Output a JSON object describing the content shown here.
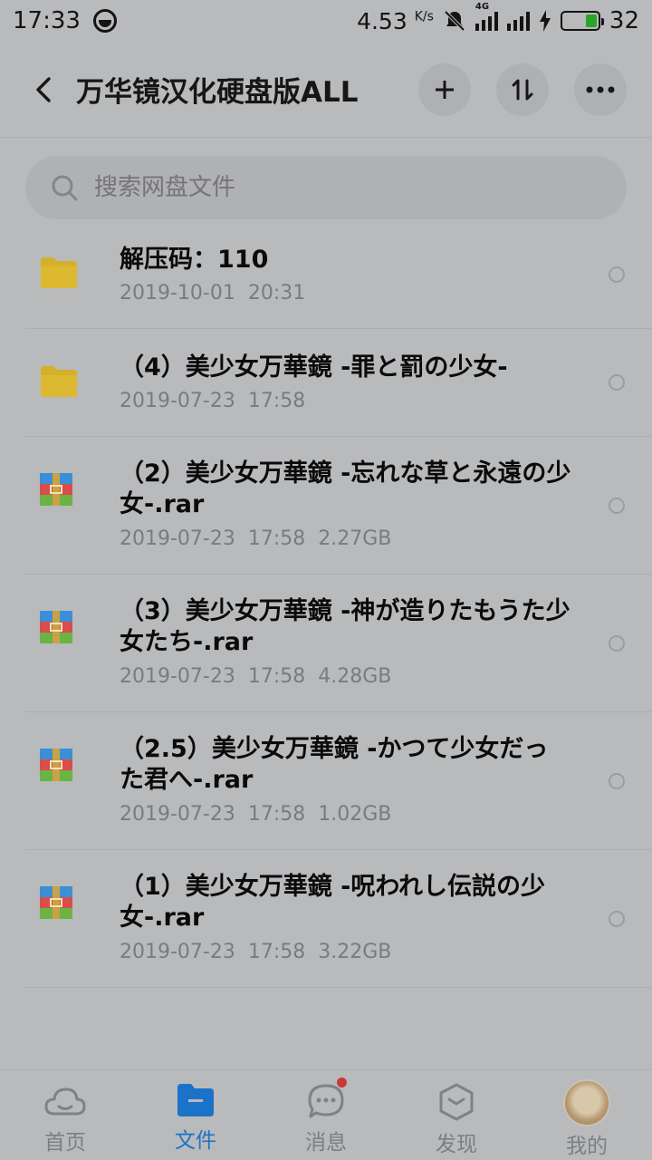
{
  "status": {
    "time": "17:33",
    "net_speed": "4.53",
    "net_unit": "K/s",
    "net_type": "4G",
    "battery": "32"
  },
  "header": {
    "title": "万华镜汉化硬盘版ALL",
    "icons": [
      "back-icon",
      "plus-icon",
      "sort-icon",
      "more-icon"
    ]
  },
  "search": {
    "placeholder": "搜索网盘文件"
  },
  "files": [
    {
      "type": "folder",
      "name": "解压码：110",
      "date": "2019-10-01",
      "time": "20:31",
      "size": ""
    },
    {
      "type": "folder",
      "name": "（4）美少女万華鏡 -罪と罰の少女-",
      "date": "2019-07-23",
      "time": "17:58",
      "size": ""
    },
    {
      "type": "rar",
      "name": "（2）美少女万華鏡 -忘れな草と永遠の少女-.rar",
      "date": "2019-07-23",
      "time": "17:58",
      "size": "2.27GB"
    },
    {
      "type": "rar",
      "name": "（3）美少女万華鏡 -神が造りたもうた少女たち-.rar",
      "date": "2019-07-23",
      "time": "17:58",
      "size": "4.28GB"
    },
    {
      "type": "rar",
      "name": "（2.5）美少女万華鏡 -かつて少女だった君へ-.rar",
      "date": "2019-07-23",
      "time": "17:58",
      "size": "1.02GB"
    },
    {
      "type": "rar",
      "name": "（1）美少女万華鏡 -呪われし伝説の少女-.rar",
      "date": "2019-07-23",
      "time": "17:58",
      "size": "3.22GB"
    }
  ],
  "nav": [
    {
      "label": "首页",
      "icon": "cloud-icon"
    },
    {
      "label": "文件",
      "icon": "folder-icon",
      "active": true
    },
    {
      "label": "消息",
      "icon": "chat-icon",
      "badge": true
    },
    {
      "label": "发现",
      "icon": "discover-icon"
    },
    {
      "label": "我的",
      "icon": "avatar"
    }
  ],
  "colors": {
    "accent": "#1a73c9",
    "folder": "#d4b12c",
    "badge": "#c63a3a"
  }
}
